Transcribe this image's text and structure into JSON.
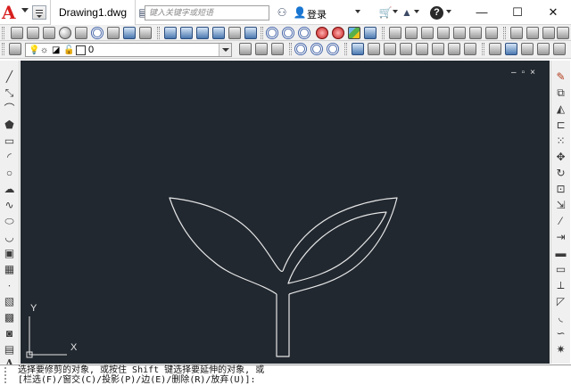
{
  "titlebar": {
    "document_tab": "Drawing1.dwg",
    "search_placeholder": "键入关键字或短语",
    "login_label": "登录",
    "help_label": "?",
    "minimize": "—",
    "maximize": "☐",
    "close": "✕"
  },
  "layer_toolbar": {
    "current_layer": "0"
  },
  "viewport": {
    "controls": "–▫×"
  },
  "ucs": {
    "x_label": "X",
    "y_label": "Y"
  },
  "command_line": {
    "line1": "选择要修剪的对象, 或按住 Shift 键选择要延伸的对象, 或",
    "line2": "[栏选(F)/窗交(C)/投影(P)/边(E)/删除(R)/放弃(U)]:"
  },
  "colors": {
    "canvas_bg": "#212830",
    "accent": "#d81e1e",
    "drawing_stroke": "#e6e6e6"
  }
}
